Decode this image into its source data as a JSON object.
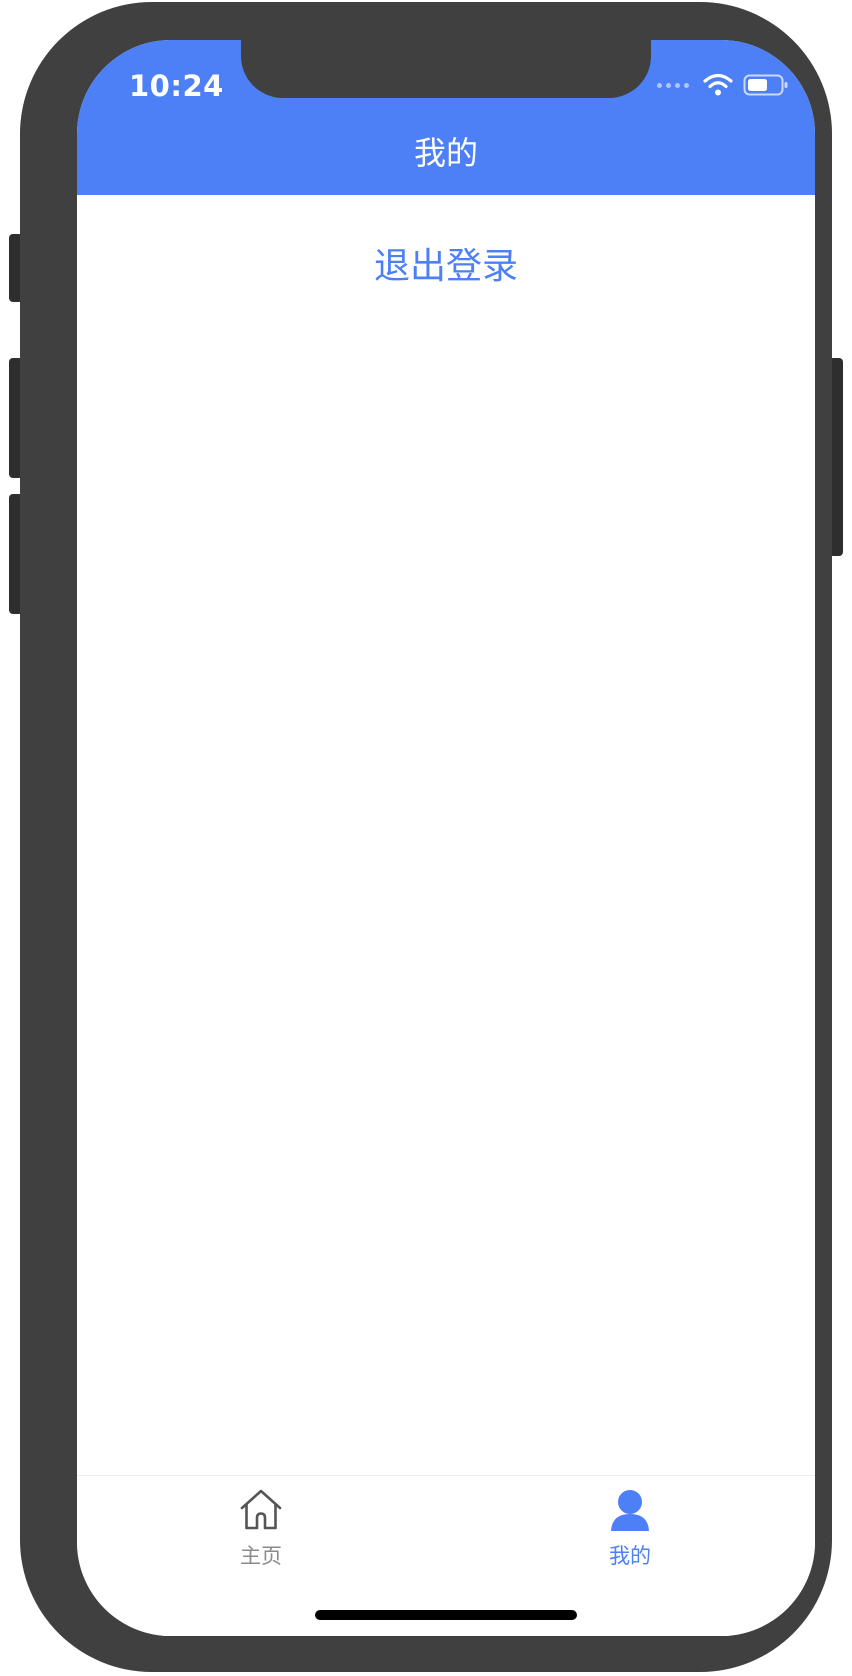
{
  "status_bar": {
    "time": "10:24",
    "icons": [
      "cellular-signal-icon",
      "wifi-icon",
      "battery-icon"
    ]
  },
  "nav_bar": {
    "title": "我的"
  },
  "main": {
    "logout_label": "退出登录"
  },
  "tab_bar": {
    "items": [
      {
        "label": "主页",
        "icon": "home-icon",
        "active": false
      },
      {
        "label": "我的",
        "icon": "user-icon",
        "active": true
      }
    ]
  },
  "colors": {
    "accent": "#4d80f6",
    "inactive_tab": "#8a8a8a",
    "frame": "#404040"
  }
}
